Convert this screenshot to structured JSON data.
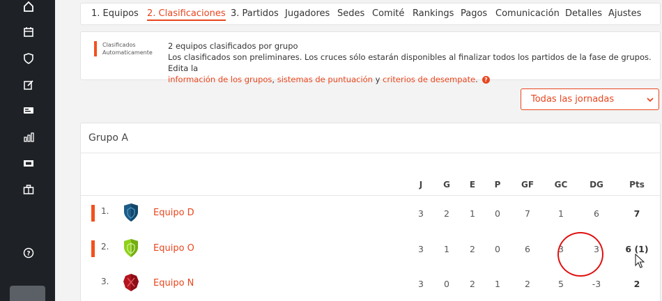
{
  "sidebar": {
    "icons": [
      "home-icon",
      "calendar-icon",
      "shield-icon",
      "edit-icon",
      "card-icon",
      "stats-icon",
      "ticket-icon",
      "briefcase-icon",
      "help-icon"
    ]
  },
  "tabs": [
    {
      "label": "1. Equipos",
      "active": false
    },
    {
      "label": "2. Clasificaciones",
      "active": true
    },
    {
      "label": "3. Partidos",
      "active": false
    },
    {
      "label": "Jugadores",
      "active": false
    },
    {
      "label": "Sedes",
      "active": false
    },
    {
      "label": "Comité",
      "active": false
    },
    {
      "label": "Rankings",
      "active": false
    },
    {
      "label": "Pagos",
      "active": false
    },
    {
      "label": "Comunicación",
      "active": false
    },
    {
      "label": "Detalles",
      "active": false
    },
    {
      "label": "Ajustes",
      "active": false
    }
  ],
  "info": {
    "legend_line1": "Clasificados",
    "legend_line2": "Automaticamente",
    "line1": "2 equipos clasificados por grupo",
    "line2": "Los clasificados son preliminares. Los cruces sólo estarán disponibles al finalizar todos los partidos de la fase de grupos. Edita la",
    "link1": "información de los grupos",
    "sep1": ", ",
    "link2": "sistemas de puntuación",
    "sep2": " y ",
    "link3": "criterios de desempate",
    "end": ".",
    "help": "?"
  },
  "filter": {
    "selected": "Todas las jornadas"
  },
  "group": {
    "title": "Grupo A",
    "headers": [
      "J",
      "G",
      "E",
      "P",
      "GF",
      "GC",
      "DG",
      "Pts"
    ],
    "rows": [
      {
        "pos": "1.",
        "team": "Equipo D",
        "qualified": true,
        "shield_color": "#1d5c86",
        "stats": [
          "3",
          "2",
          "1",
          "0",
          "7",
          "1",
          "6",
          "7"
        ]
      },
      {
        "pos": "2.",
        "team": "Equipo O",
        "qualified": true,
        "shield_color": "#8fd11c",
        "stats": [
          "3",
          "1",
          "2",
          "0",
          "6",
          "3",
          "3",
          "6 (1)"
        ]
      },
      {
        "pos": "3.",
        "team": "Equipo N",
        "qualified": false,
        "shield_color": "#b3141e",
        "stats": [
          "3",
          "0",
          "2",
          "1",
          "2",
          "5",
          "-3",
          "2"
        ]
      }
    ]
  },
  "colors": {
    "accent": "#e8461e",
    "sidebar": "#1e2126",
    "highlight": "#e01010"
  }
}
